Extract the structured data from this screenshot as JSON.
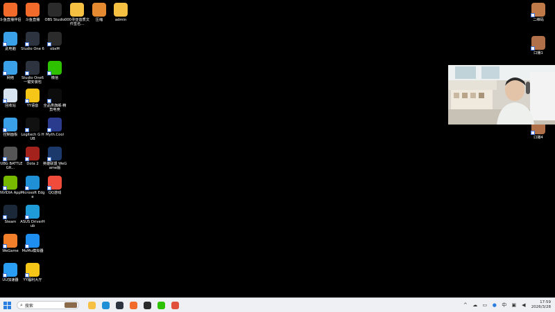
{
  "desktop_icons": [
    {
      "label": "斗鱼直播伴侣",
      "icon": "douyu-companion-icon",
      "color": "#f26b2b"
    },
    {
      "label": "斗鱼直播",
      "icon": "douyu-live-icon",
      "color": "#f26b2b"
    },
    {
      "label": "OBS Studio",
      "icon": "obs-studio-icon",
      "color": "#2b2b2b"
    },
    {
      "label": "000寻亚音质文件签名...",
      "icon": "folder-icon",
      "color": "#f6c043"
    },
    {
      "label": "压缩",
      "icon": "archive-icon",
      "color": "#e58a30"
    },
    {
      "label": "admin",
      "icon": "user-folder-icon",
      "color": "#f6c043"
    },
    {
      "label": "此电脑",
      "icon": "this-pc-icon",
      "color": "#3aa0e8"
    },
    {
      "label": "Studio One 6",
      "icon": "studio-one-icon",
      "color": "#2d3440"
    },
    {
      "label": "obsM",
      "icon": "obsm-icon",
      "color": "#2b2b2b"
    },
    {
      "label": "网络",
      "icon": "network-icon",
      "color": "#3aa0e8"
    },
    {
      "label": "Studio One6 一键安装包",
      "icon": "studio-one-installer-icon",
      "color": "#2d3440"
    },
    {
      "label": "微信",
      "icon": "wechat-icon",
      "color": "#2dc100"
    },
    {
      "label": "回收站",
      "icon": "recycle-bin-icon",
      "color": "#d8e4ef"
    },
    {
      "label": "YY语音",
      "icon": "yy-voice-icon",
      "color": "#f5c518"
    },
    {
      "label": "全品类旗舰-精剪电竞",
      "icon": "esports-app-icon",
      "color": "#0c0c0c"
    },
    {
      "label": "控制面板",
      "icon": "control-panel-icon",
      "color": "#3aa0e8"
    },
    {
      "label": "Logitech G HUB",
      "icon": "logitech-ghub-icon",
      "color": "#111"
    },
    {
      "label": "Myth.Cool",
      "icon": "myth-cool-icon",
      "color": "#2a3a8c"
    },
    {
      "label": "PUBG BATTLEGR...",
      "icon": "pubg-icon",
      "color": "#555"
    },
    {
      "label": "Dota 2",
      "icon": "dota2-icon",
      "color": "#a3221b"
    },
    {
      "label": "英雄联盟 WeGame版",
      "icon": "league-of-legends-icon",
      "color": "#1b3a6b"
    },
    {
      "label": "NVIDIA App",
      "icon": "nvidia-icon",
      "color": "#76b900"
    },
    {
      "label": "Microsoft Edge",
      "icon": "edge-icon",
      "color": "#1f8fd6"
    },
    {
      "label": "QQ游戏",
      "icon": "qq-games-icon",
      "color": "#f04b3b"
    },
    {
      "label": "Steam",
      "icon": "steam-icon",
      "color": "#1b2838"
    },
    {
      "label": "ASUS DriverHub",
      "icon": "asus-driverhub-icon",
      "color": "#1f9bd7"
    },
    {
      "label": "WeGame",
      "icon": "wegame-icon",
      "color": "#f37f2a"
    },
    {
      "label": "MuMu模拟器",
      "icon": "mumu-emulator-icon",
      "color": "#1f8ef1"
    },
    {
      "label": "UU加速器",
      "icon": "uu-accelerator-icon",
      "color": "#2a9df4"
    },
    {
      "label": "YY福利大厅",
      "icon": "yy-welfare-icon",
      "color": "#f5c518"
    },
    {
      "label": "二维码",
      "icon": "qr-code-icon",
      "color": "#c07a4a"
    },
    {
      "label": "口播1",
      "icon": "script-file-icon",
      "color": "#b0704a"
    },
    {
      "label": "口播4",
      "icon": "script-file-icon",
      "color": "#b0704a"
    }
  ],
  "taskbar": {
    "search_placeholder": "搜索",
    "apps": [
      "file-explorer-icon",
      "edge-icon",
      "obs-studio-icon",
      "douyu-icon",
      "obs-icon",
      "wechat-icon",
      "douyu-companion-icon"
    ],
    "clock_time": "17:59",
    "clock_date": "2026/3/28"
  }
}
